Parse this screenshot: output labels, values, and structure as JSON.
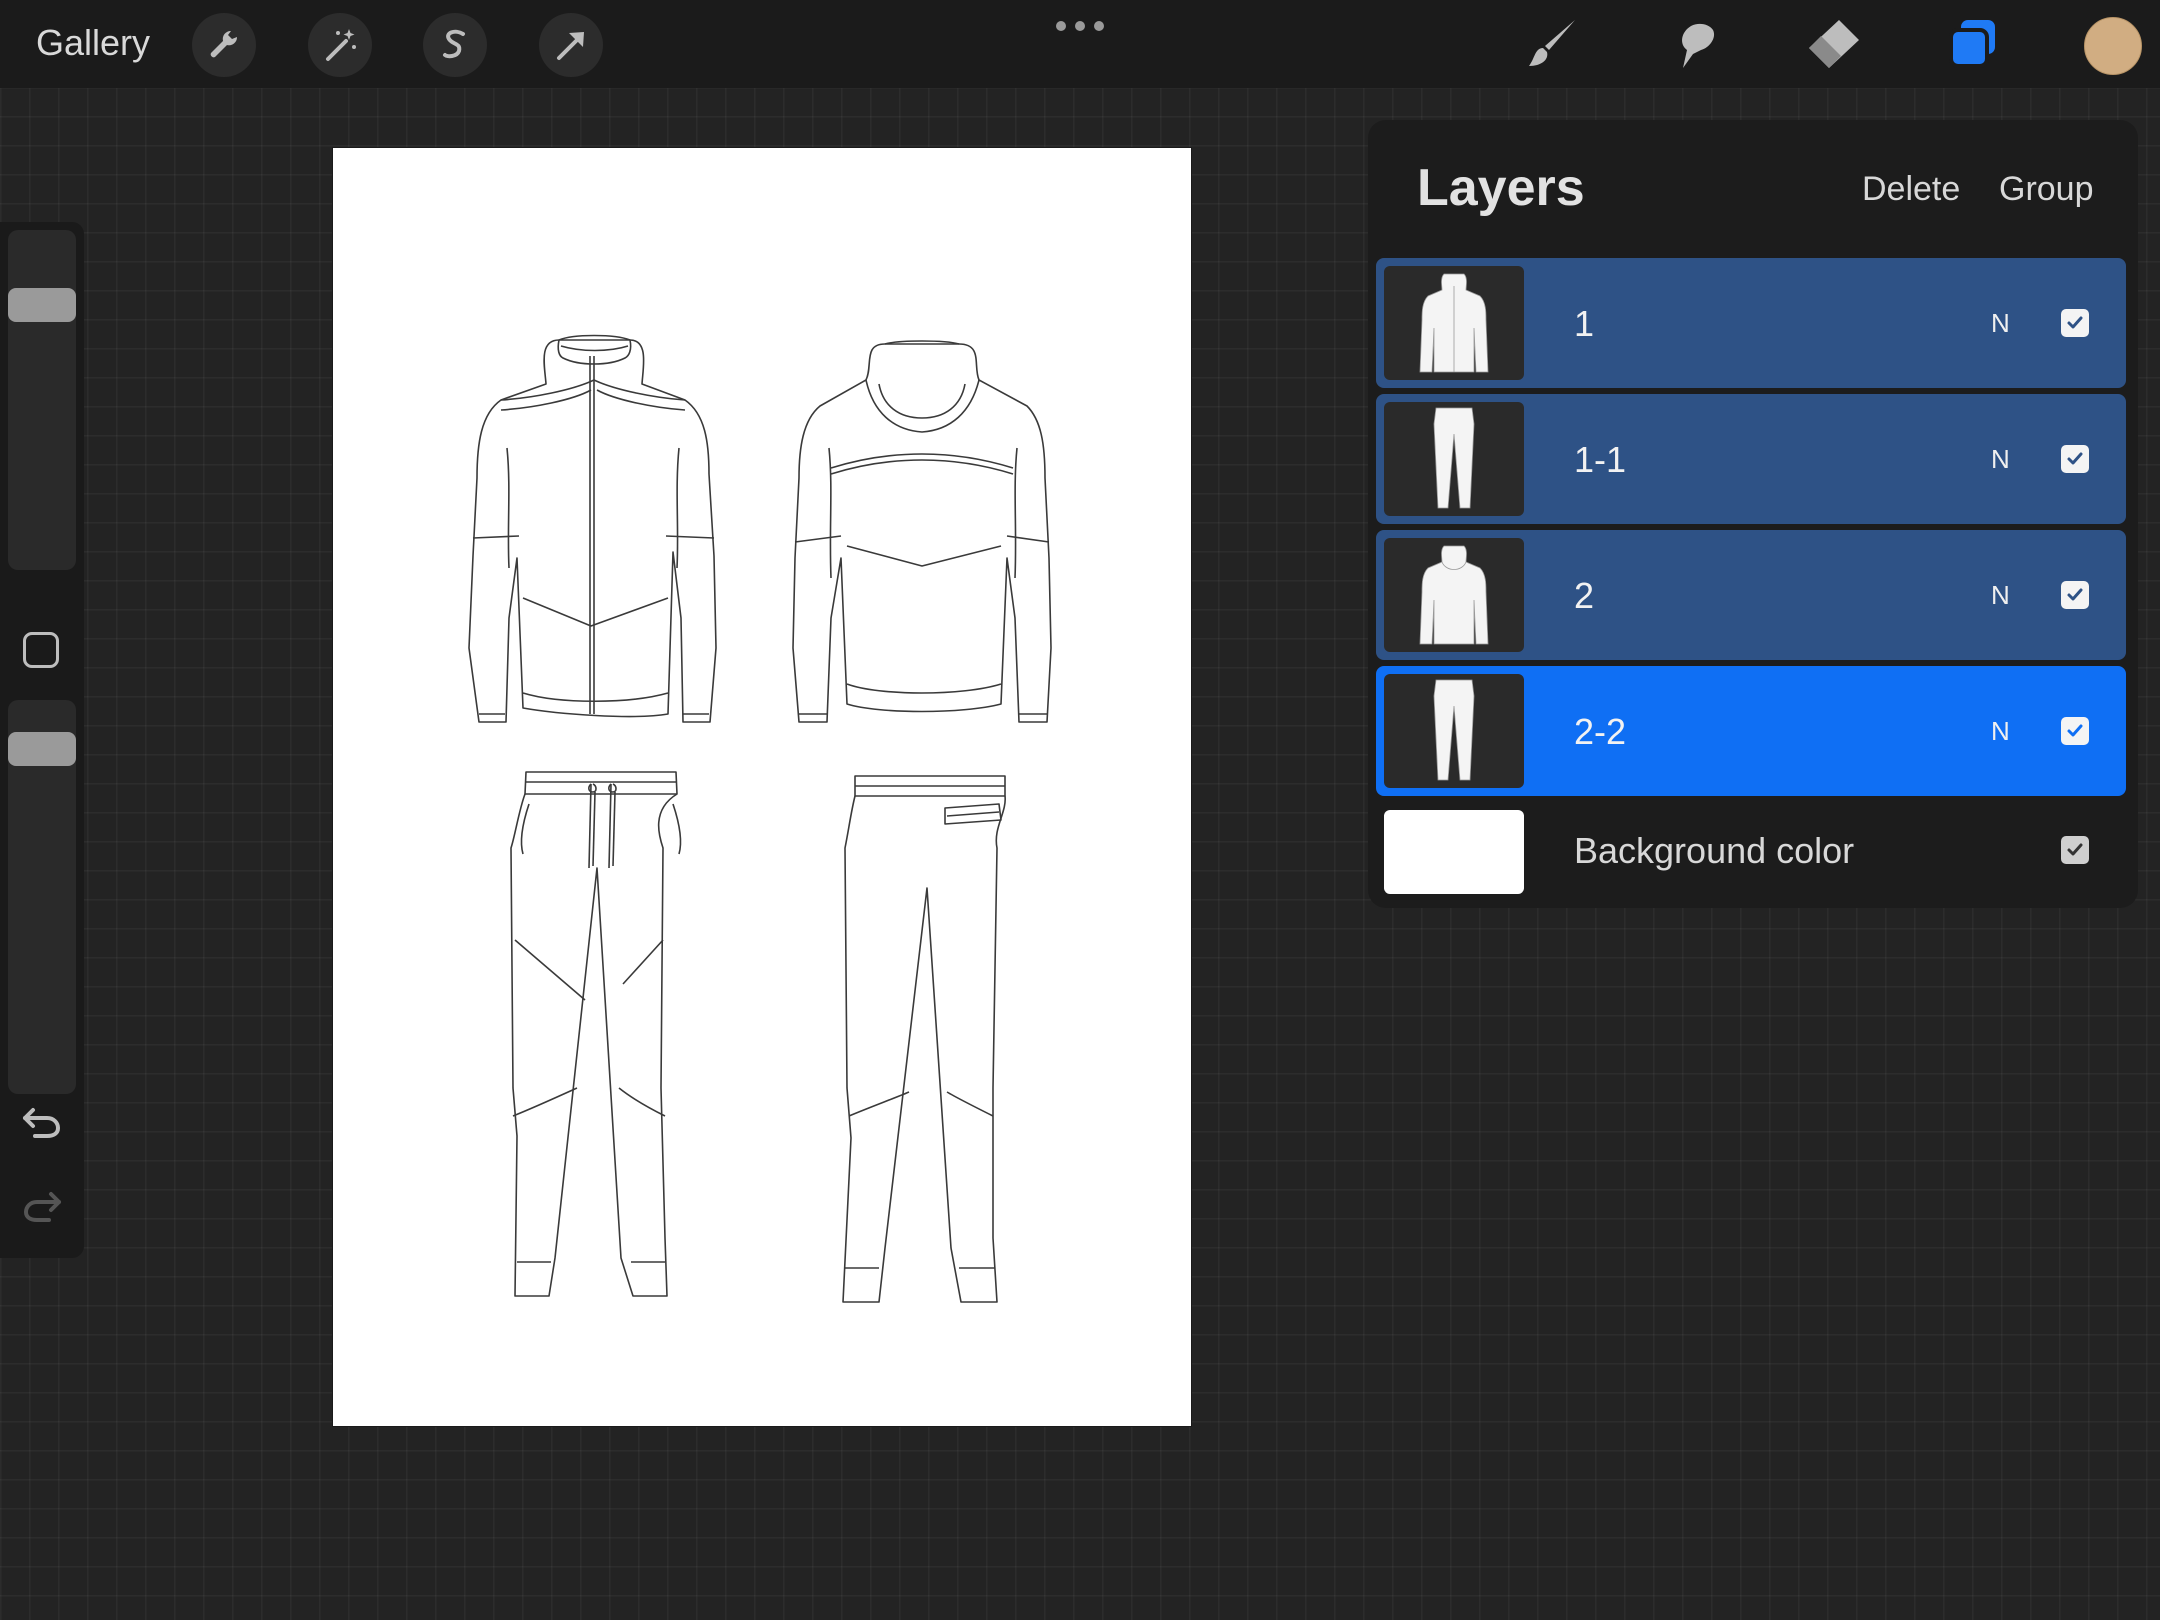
{
  "topbar": {
    "gallery_label": "Gallery",
    "tools_left": [
      "wrench-icon",
      "magic-wand-icon",
      "selection-icon",
      "transform-arrow-icon"
    ],
    "tools_right": [
      "brush-icon",
      "smudge-icon",
      "eraser-icon",
      "layers-icon"
    ],
    "active_tool_color": "#1f7af5",
    "current_color": "#d1ad82"
  },
  "layers_panel": {
    "title": "Layers",
    "delete_label": "Delete",
    "group_label": "Group",
    "layers": [
      {
        "name": "1",
        "blend": "N",
        "visible": true,
        "selected": true,
        "active": false,
        "thumb": "jacket"
      },
      {
        "name": "1-1",
        "blend": "N",
        "visible": true,
        "selected": true,
        "active": false,
        "thumb": "pants"
      },
      {
        "name": "2",
        "blend": "N",
        "visible": true,
        "selected": true,
        "active": false,
        "thumb": "jacket"
      },
      {
        "name": "2-2",
        "blend": "N",
        "visible": true,
        "selected": true,
        "active": true,
        "thumb": "pants"
      }
    ],
    "background": {
      "name": "Background color",
      "visible": true,
      "color": "#ffffff"
    }
  }
}
